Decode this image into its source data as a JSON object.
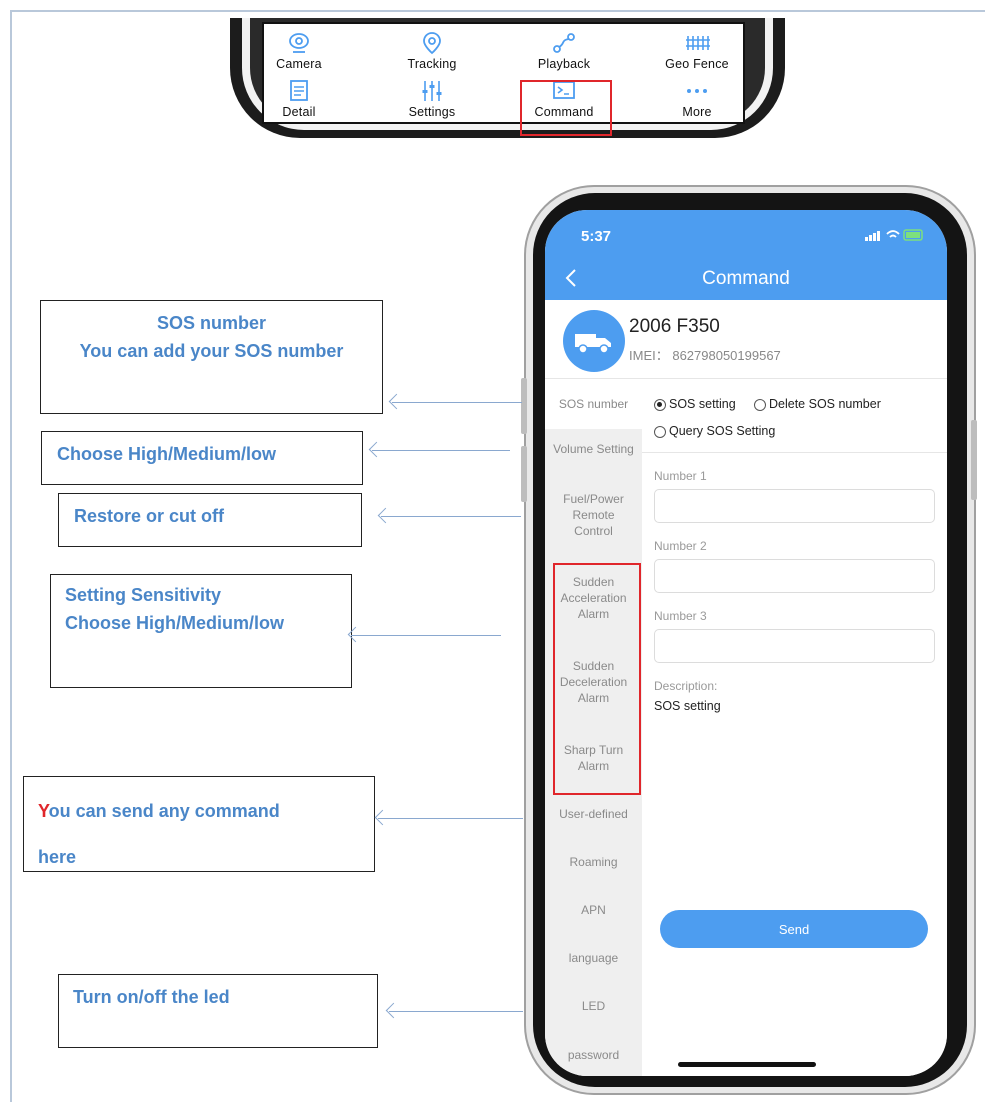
{
  "top_menu": {
    "items": [
      {
        "label": "Camera",
        "icon": "camera-icon"
      },
      {
        "label": "Tracking",
        "icon": "location-pin-icon"
      },
      {
        "label": "Playback",
        "icon": "route-icon"
      },
      {
        "label": "Geo Fence",
        "icon": "fence-icon"
      },
      {
        "label": "Detail",
        "icon": "document-icon"
      },
      {
        "label": "Settings",
        "icon": "sliders-icon"
      },
      {
        "label": "Command",
        "icon": "terminal-icon"
      },
      {
        "label": "More",
        "icon": "more-dots-icon"
      }
    ]
  },
  "phone": {
    "time": "5:37",
    "nav_title": "Command",
    "device": {
      "name": "2006 F350",
      "imei": "IMEI： 862798050199567"
    },
    "sidebar": [
      "SOS number",
      "Volume Setting",
      "Fuel/Power Remote Control",
      "Sudden Acceleration Alarm",
      "Sudden Deceleration Alarm",
      "Sharp Turn Alarm",
      "User-defined",
      "Roaming",
      "APN",
      "language",
      "LED",
      "password"
    ],
    "options": {
      "sos_setting": "SOS setting",
      "delete_sos": "Delete SOS number",
      "query_sos": "Query SOS Setting"
    },
    "fields": {
      "number1": "Number 1",
      "number2": "Number 2",
      "number3": "Number 3",
      "description_label": "Description:",
      "description_value": "SOS setting"
    },
    "send_label": "Send"
  },
  "callouts": {
    "sos_title": "SOS number",
    "sos_body": "You can add your SOS number",
    "volume": "Choose High/Medium/low",
    "fuel": "Restore or cut off",
    "sensitivity_title": "Setting Sensitivity",
    "sensitivity_body": "Choose High/Medium/low",
    "custom_first": "Y",
    "custom_rest": "ou can send any command",
    "custom_line2": "here",
    "led": "Turn on/off the led"
  },
  "colors": {
    "accent": "#4d9df0",
    "highlight": "#e0262b",
    "callout_text": "#4a86c8"
  }
}
